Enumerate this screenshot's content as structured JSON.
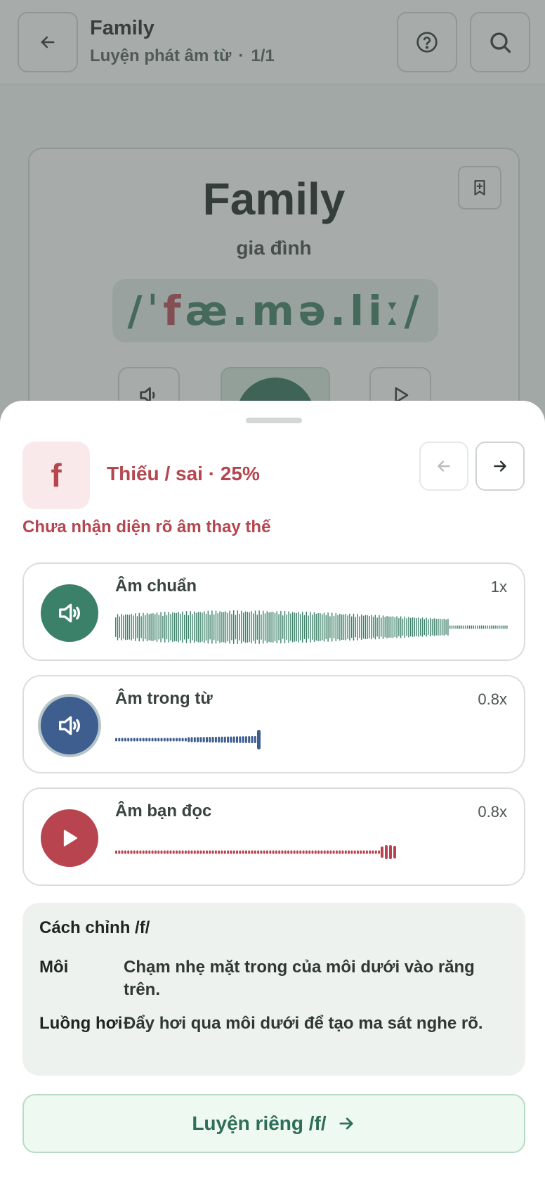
{
  "header": {
    "title": "Family",
    "subtitle": "Luyện phát âm từ",
    "separator": "·",
    "progress": "1/1",
    "icons": [
      "arrow-left-icon",
      "help-icon",
      "search-icon"
    ]
  },
  "word_card": {
    "word": "Family",
    "meaning": "gia đình",
    "ipa_slash_open": "/",
    "ipa_stress": "ˈ",
    "ipa_error": "f",
    "ipa_rest": "æ.mə.liː",
    "ipa_slash_close": "/"
  },
  "sheet": {
    "phoneme": "f",
    "status": "Thiếu / sai · 25%",
    "hint": "Chưa nhận diện rõ âm thay thế",
    "audio": [
      {
        "label": "Âm chuẩn",
        "speed": "1x",
        "color": "#3b8068",
        "icon": "speaker-icon"
      },
      {
        "label": "Âm trong từ",
        "speed": "0.8x",
        "color": "#3d5e8e",
        "icon": "speaker-icon"
      },
      {
        "label": "Âm bạn đọc",
        "speed": "0.8x",
        "color": "#b8444f",
        "icon": "play-icon"
      }
    ],
    "tips": {
      "title": "Cách chỉnh /f/",
      "rows": [
        {
          "key": "Môi",
          "value": "Chạm nhẹ mặt trong của môi dưới vào răng trên."
        },
        {
          "key": "Luồng hơi",
          "value": "Đẩy hơi qua môi dưới để tạo ma sát nghe rõ."
        }
      ]
    },
    "practice_label": "Luyện riêng /f/"
  },
  "colors": {
    "accent_green": "#3b8068",
    "error_red": "#b5454f",
    "blue": "#3d5e8e"
  }
}
